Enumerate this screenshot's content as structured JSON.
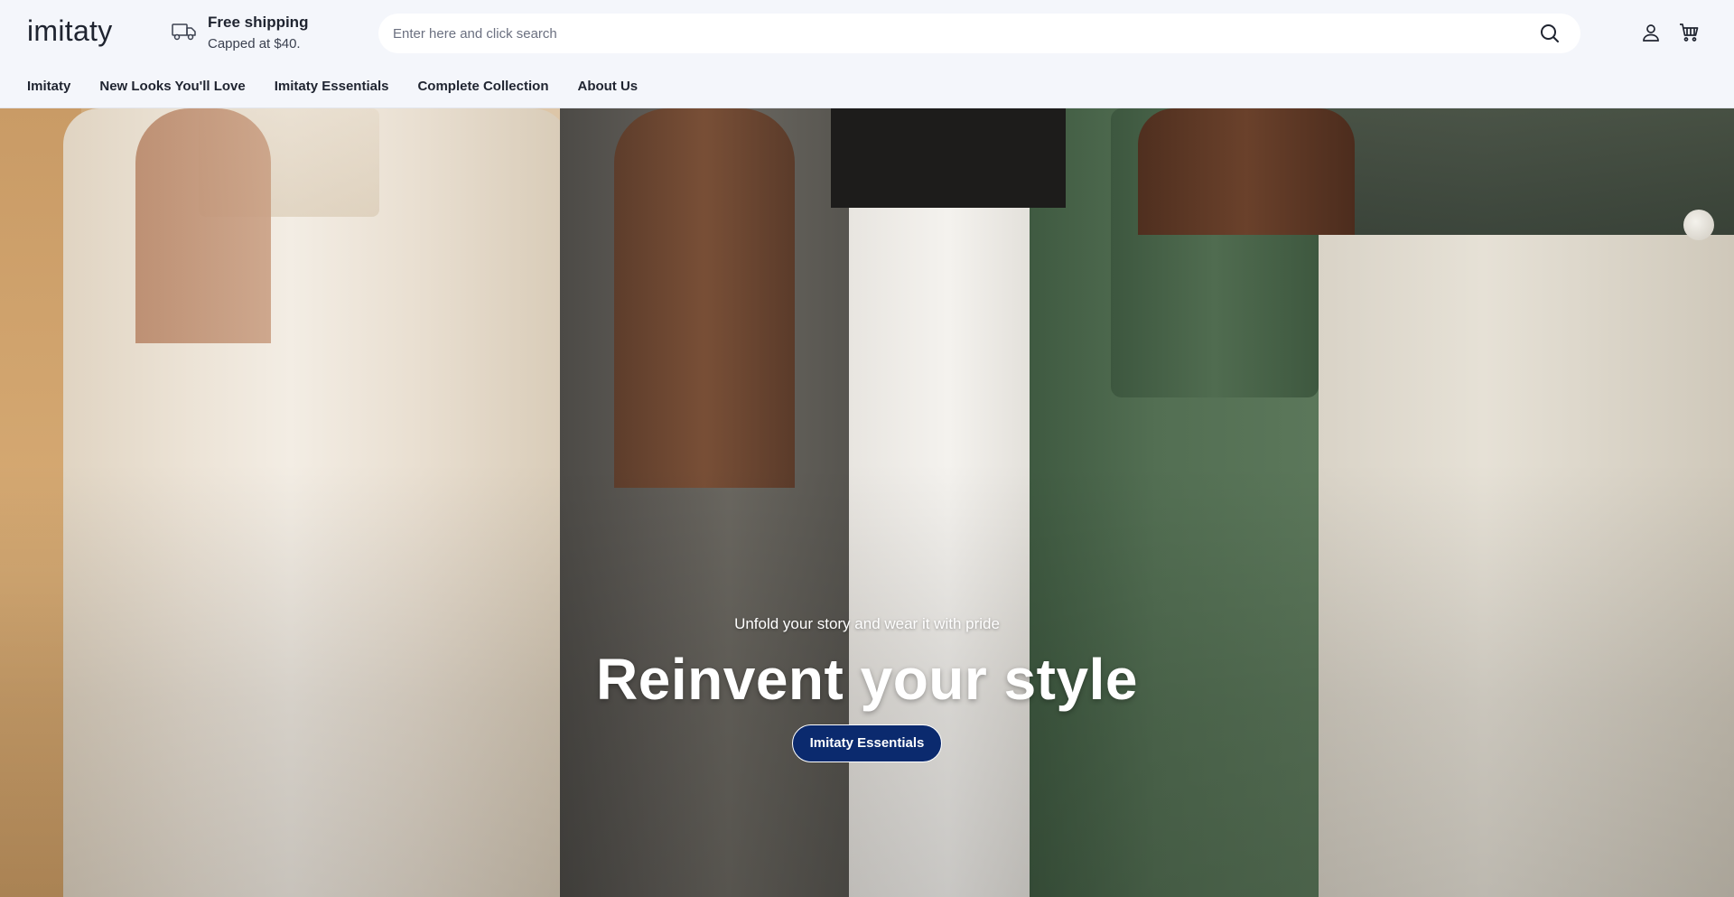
{
  "header": {
    "logo": "imitaty",
    "shipping": {
      "title": "Free shipping",
      "subtitle": "Capped at $40."
    },
    "search": {
      "placeholder": "Enter here and click search",
      "value": ""
    },
    "icons": {
      "search": "search-icon",
      "account": "account-icon",
      "cart": "cart-icon",
      "shipping": "truck-icon"
    }
  },
  "nav": {
    "items": [
      {
        "label": "Imitaty"
      },
      {
        "label": "New Looks You'll Love"
      },
      {
        "label": "Imitaty Essentials"
      },
      {
        "label": "Complete Collection"
      },
      {
        "label": "About Us"
      }
    ]
  },
  "hero": {
    "tagline": "Unfold your story and wear it with pride",
    "headline": "Reinvent your style",
    "cta_label": "Imitaty Essentials"
  },
  "colors": {
    "background": "#f4f6fb",
    "text": "#1f2430",
    "cta_background": "#0b2a6e",
    "cta_text": "#ffffff"
  }
}
